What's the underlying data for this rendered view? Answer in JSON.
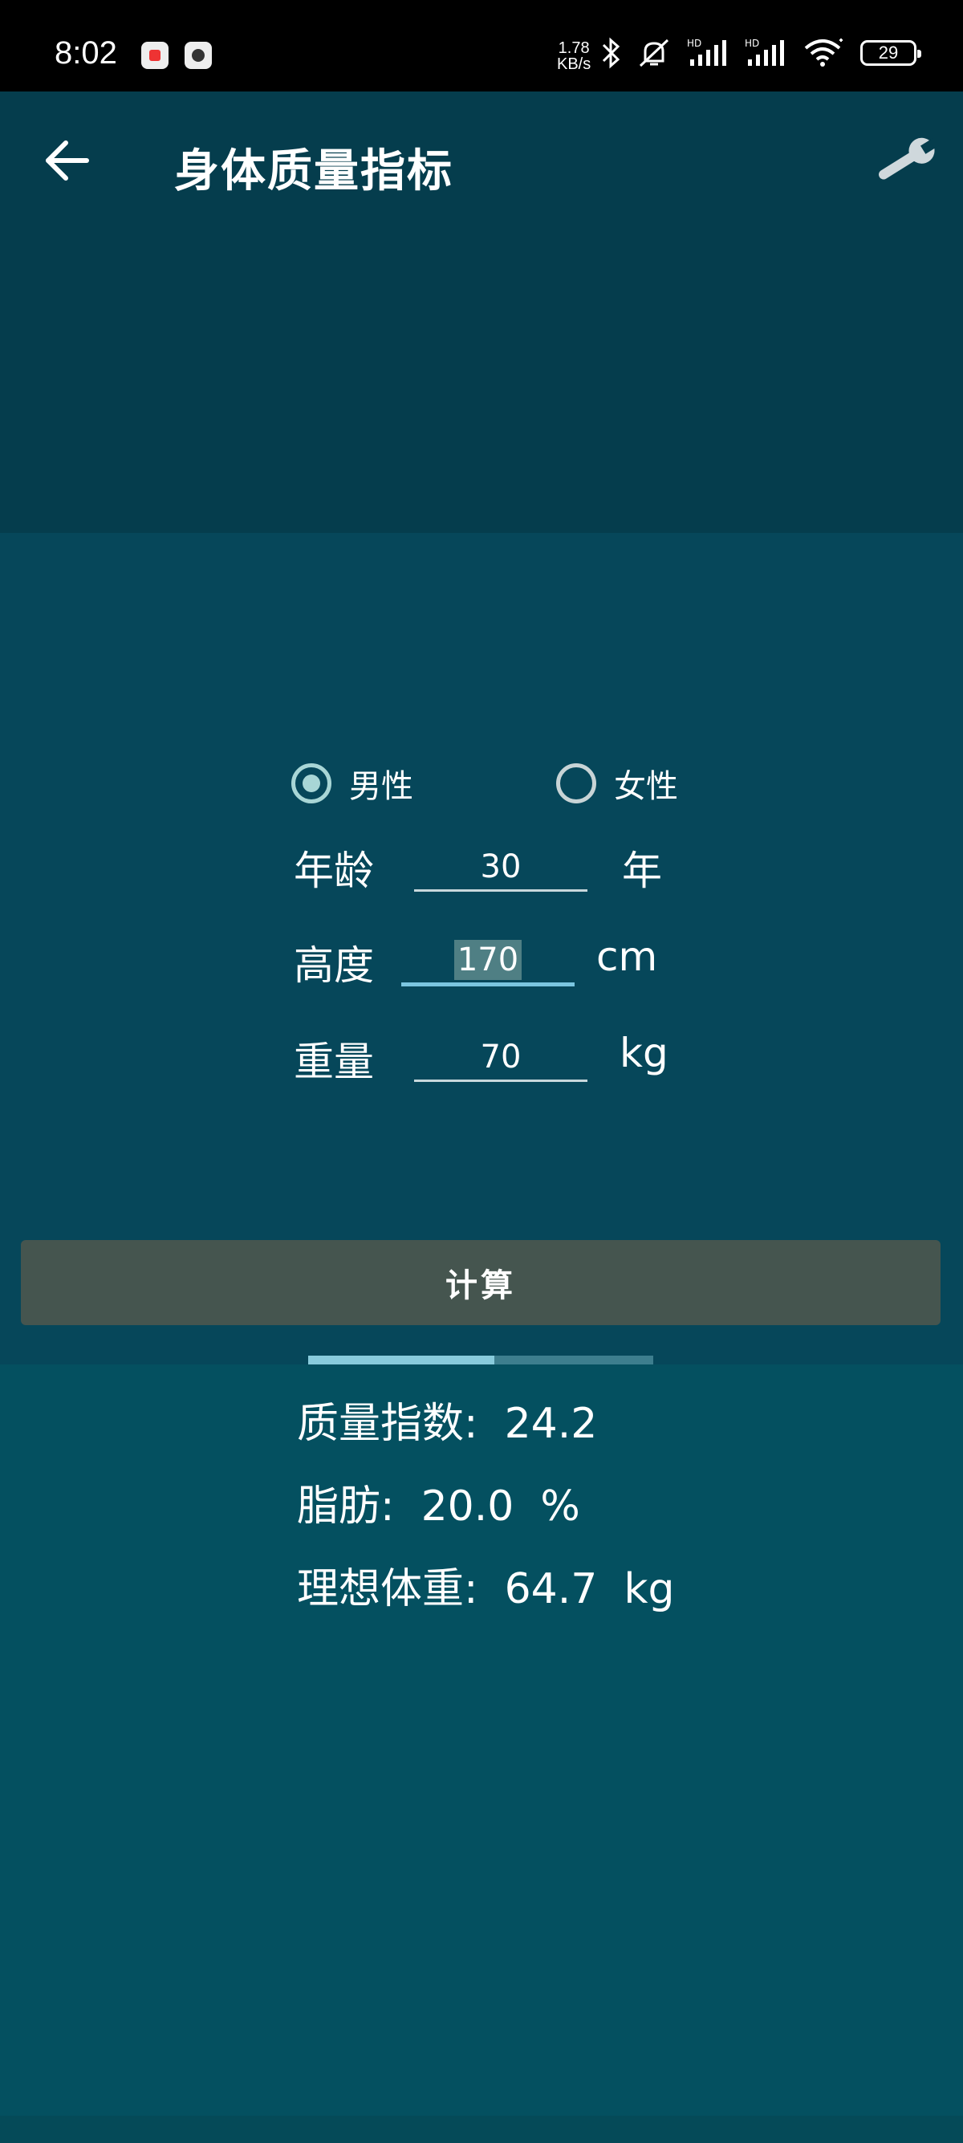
{
  "status_bar": {
    "time": "8:02",
    "net_speed_value": "1.78",
    "net_speed_unit": "KB/s",
    "battery": "29",
    "icons": [
      "bluetooth-icon",
      "mute-icon",
      "hd-signal-icon",
      "hd-signal-icon",
      "wifi-icon",
      "battery-icon"
    ]
  },
  "app_bar": {
    "title": "身体质量指标",
    "back_icon": "arrow-left-icon",
    "settings_icon": "wrench-icon"
  },
  "form": {
    "gender_options": [
      {
        "label": "男性",
        "selected": true
      },
      {
        "label": "女性",
        "selected": false
      }
    ],
    "age": {
      "label": "年龄",
      "value": "30",
      "unit": "年"
    },
    "height": {
      "label": "高度",
      "value": "170",
      "unit": "cm"
    },
    "weight": {
      "label": "重量",
      "value": "70",
      "unit": "kg"
    }
  },
  "calculate_label": "计算",
  "progress_fraction": 0.54,
  "results": {
    "bmi": "质量指数:  24.2",
    "fat": "脂肪:  20.0  %",
    "ideal_weight": "理想体重:  64.7  kg"
  },
  "colors": {
    "app_bar_bg": "#053d4d",
    "panel_bg": "#06475a",
    "results_bg": "#045060",
    "accent": "#a8d6d6",
    "button_bg": "#45554f"
  }
}
